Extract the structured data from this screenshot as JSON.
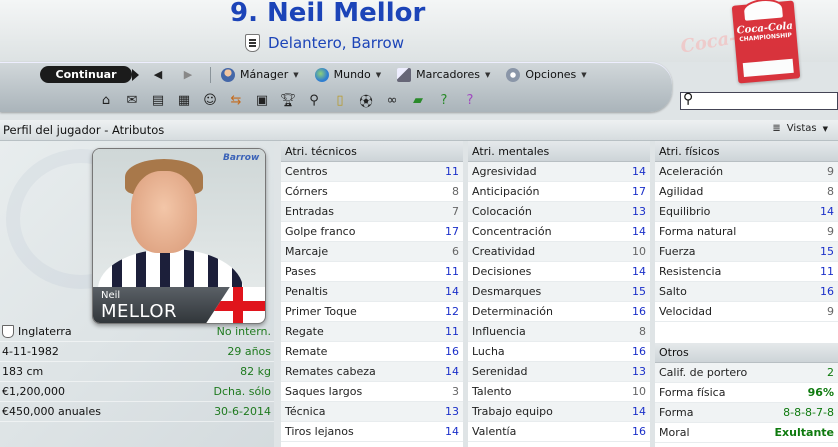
{
  "header": {
    "player_name": "9. Neil Mellor",
    "subtitle": "Delantero, Barrow",
    "sponsor_text": "Coca-Cola",
    "sponsor_sub": "CHAMPIONSHIP"
  },
  "navbar": {
    "continue_label": "Continuar",
    "menus": [
      {
        "label": "Mánager",
        "icon": "manager-icon"
      },
      {
        "label": "Mundo",
        "icon": "globe-icon"
      },
      {
        "label": "Marcadores",
        "icon": "bookmark-icon"
      },
      {
        "label": "Opciones",
        "icon": "options-icon"
      }
    ],
    "toolbar_icons": [
      "home-icon",
      "inbox-icon",
      "news-icon",
      "calendar-icon",
      "squad-icon",
      "transfers-icon",
      "tactics-icon",
      "trophy-icon",
      "scout-icon",
      "notes-icon",
      "match-icon",
      "binoculars-icon",
      "finances-icon",
      "help-icon",
      "info-icon"
    ]
  },
  "page": {
    "title": "Perfil del jugador - Atributos",
    "views_label": "Vistas"
  },
  "profile": {
    "first_name": "Neil",
    "last_name": "MELLOR",
    "photo_logo": "Barrow",
    "rows": [
      {
        "left": "Inglaterra",
        "right": "No intern."
      },
      {
        "left": "4-11-1982",
        "right": "29 años"
      },
      {
        "left": "183 cm",
        "right": "82 kg"
      },
      {
        "left": "€1,200,000",
        "right": "Dcha. sólo"
      },
      {
        "left": "€450,000 anuales",
        "right": "30-6-2014"
      }
    ]
  },
  "technical": {
    "title": "Atri. técnicos",
    "attrs": [
      {
        "name": "Centros",
        "value": "11",
        "tone": "blue"
      },
      {
        "name": "Córners",
        "value": "8",
        "tone": "grey"
      },
      {
        "name": "Entradas",
        "value": "7",
        "tone": "grey"
      },
      {
        "name": "Golpe franco",
        "value": "17",
        "tone": "blue"
      },
      {
        "name": "Marcaje",
        "value": "6",
        "tone": "grey"
      },
      {
        "name": "Pases",
        "value": "11",
        "tone": "blue"
      },
      {
        "name": "Penaltis",
        "value": "14",
        "tone": "blue"
      },
      {
        "name": "Primer Toque",
        "value": "12",
        "tone": "blue"
      },
      {
        "name": "Regate",
        "value": "11",
        "tone": "blue"
      },
      {
        "name": "Remate",
        "value": "16",
        "tone": "blue"
      },
      {
        "name": "Remates cabeza",
        "value": "14",
        "tone": "blue"
      },
      {
        "name": "Saques largos",
        "value": "3",
        "tone": "grey"
      },
      {
        "name": "Técnica",
        "value": "13",
        "tone": "blue"
      },
      {
        "name": "Tiros lejanos",
        "value": "14",
        "tone": "blue"
      }
    ]
  },
  "mental": {
    "title": "Atri. mentales",
    "attrs": [
      {
        "name": "Agresividad",
        "value": "14",
        "tone": "blue"
      },
      {
        "name": "Anticipación",
        "value": "17",
        "tone": "blue"
      },
      {
        "name": "Colocación",
        "value": "13",
        "tone": "blue"
      },
      {
        "name": "Concentración",
        "value": "14",
        "tone": "blue"
      },
      {
        "name": "Creatividad",
        "value": "10",
        "tone": "grey"
      },
      {
        "name": "Decisiones",
        "value": "14",
        "tone": "blue"
      },
      {
        "name": "Desmarques",
        "value": "15",
        "tone": "blue"
      },
      {
        "name": "Determinación",
        "value": "16",
        "tone": "blue"
      },
      {
        "name": "Influencia",
        "value": "8",
        "tone": "grey"
      },
      {
        "name": "Lucha",
        "value": "16",
        "tone": "blue"
      },
      {
        "name": "Serenidad",
        "value": "13",
        "tone": "blue"
      },
      {
        "name": "Talento",
        "value": "10",
        "tone": "grey"
      },
      {
        "name": "Trabajo equipo",
        "value": "14",
        "tone": "blue"
      },
      {
        "name": "Valentía",
        "value": "16",
        "tone": "blue"
      }
    ]
  },
  "physical": {
    "title": "Atri. físicos",
    "attrs": [
      {
        "name": "Aceleración",
        "value": "9",
        "tone": "grey"
      },
      {
        "name": "Agilidad",
        "value": "8",
        "tone": "grey"
      },
      {
        "name": "Equilibrio",
        "value": "14",
        "tone": "blue"
      },
      {
        "name": "Forma natural",
        "value": "9",
        "tone": "grey"
      },
      {
        "name": "Fuerza",
        "value": "15",
        "tone": "blue"
      },
      {
        "name": "Resistencia",
        "value": "11",
        "tone": "blue"
      },
      {
        "name": "Salto",
        "value": "16",
        "tone": "blue"
      },
      {
        "name": "Velocidad",
        "value": "9",
        "tone": "grey"
      }
    ],
    "others_title": "Otros",
    "others": [
      {
        "name": "Calif. de portero",
        "value": "2",
        "tone": "green"
      },
      {
        "name": "Forma física",
        "value": "96%",
        "tone": "green"
      },
      {
        "name": "Forma",
        "value": "8-8-8-7-8",
        "tone": "green"
      },
      {
        "name": "Moral",
        "value": "Exultante",
        "tone": "green"
      }
    ]
  },
  "colors": {
    "title_blue": "#1c44b8",
    "value_blue": "#1a2fc9",
    "value_green": "#0e7a0e",
    "nav_dark": "#1b1b1b"
  }
}
